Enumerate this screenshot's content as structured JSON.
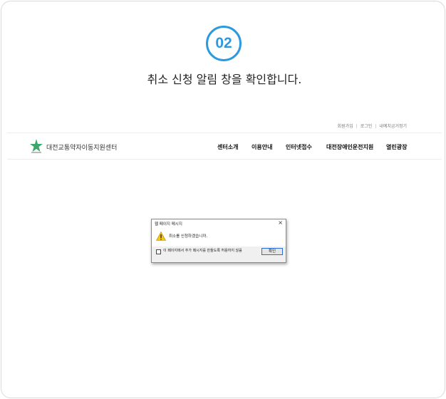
{
  "step": {
    "number": "02",
    "title": "취소 신청 알림 창을 확인합니다."
  },
  "utility_nav": [
    "회원가입",
    "로그인",
    "내예치금거정기"
  ],
  "site": {
    "name": "대전교통약자이동지원센터",
    "logo_icon": "star-logo-icon",
    "brand_color": "#2c9adf"
  },
  "main_nav": [
    "센터소개",
    "이용안내",
    "인터넷접수",
    "대전장애인운전지원",
    "열린광장"
  ],
  "dialog": {
    "title": "웹 페이지 메시지",
    "close": "×",
    "message": "취소를 신청하겠습니까.",
    "checkbox_label": "이 페이지에서 추가 메시지를 만들도록 허용하지 않음",
    "ok_label": "확인",
    "icon": "warning-icon"
  }
}
